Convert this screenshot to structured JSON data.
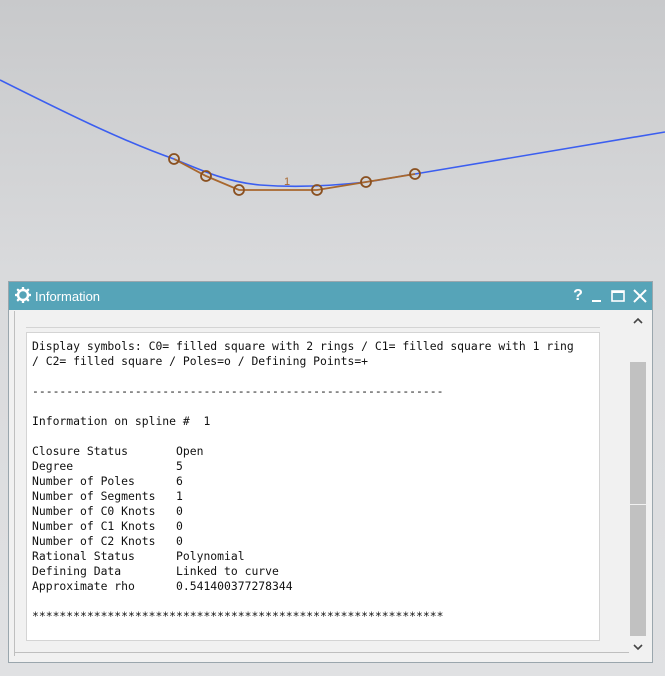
{
  "viewport": {
    "spline_label": "1",
    "colors": {
      "curve": "#3b5ef0",
      "polygon": "#a8672e"
    }
  },
  "dialog": {
    "title": "Information",
    "help_label": "?",
    "icons": {
      "title": "gear-icon",
      "minimize": "minimize-icon",
      "maximize": "maximize-icon",
      "close": "close-icon"
    }
  },
  "info": {
    "text": "Display symbols: C0= filled square with 2 rings / C1= filled square with 1 ring\n/ C2= filled square / Poles=o / Defining Points=+\n\n------------------------------------------------------------\n\nInformation on spline #  1\n\nClosure Status       Open\nDegree               5\nNumber of Poles      6\nNumber of Segments   1\nNumber of C0 Knots   0\nNumber of C1 Knots   0\nNumber of C2 Knots   0\nRational Status      Polynomial\nDefining Data        Linked to curve\nApproximate rho      0.541400377278344\n\n************************************************************"
  }
}
